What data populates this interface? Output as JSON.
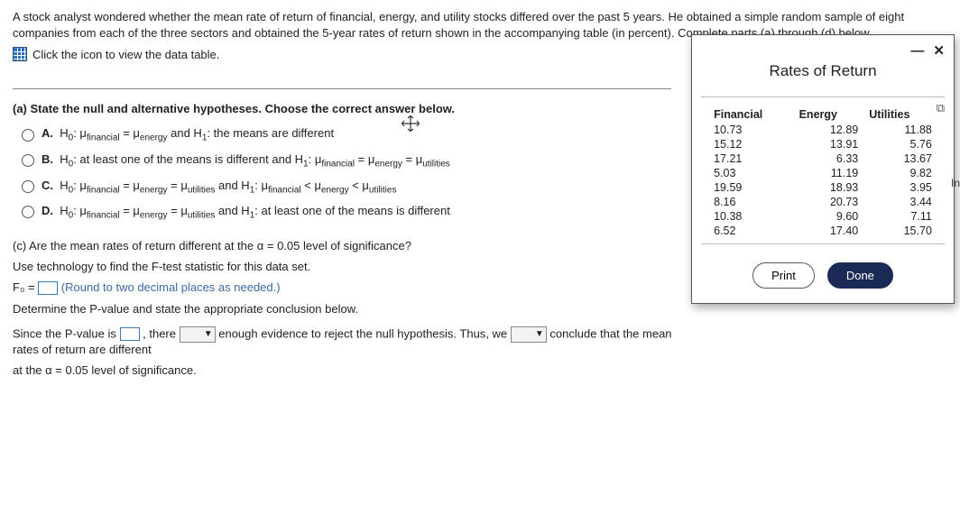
{
  "intro": "A stock analyst wondered whether the mean rate of return of financial, energy, and utility stocks differed over the past 5 years. He obtained a simple random sample of eight companies from each of the three sectors and obtained the 5-year rates of return shown in the accompanying table (in percent). Complete parts (a) through (d) below.",
  "iconRow": "Click the icon to view the data table.",
  "partA": {
    "prompt": "(a) State the null and alternative hypotheses. Choose the correct answer below.",
    "options": {
      "A": {
        "letter": "A.",
        "pre": "H",
        "sub0": "0",
        "text1": ": μ",
        "subF": "financial",
        "eq": " = μ",
        "subE": "energy",
        "tail": " and H",
        "sub1": "1",
        "tail2": ": the means are different"
      },
      "B": {
        "letter": "B.",
        "text": "H₀: at least one of the means is different and H₁: μfinancial = μenergy = μutilities"
      },
      "C": {
        "letter": "C.",
        "text": "H₀: μfinancial = μenergy = μutilities and H₁: μfinancial < μenergy < μutilities"
      },
      "D": {
        "letter": "D.",
        "text": "H₀: μfinancial = μenergy = μutilities and H₁: at least one of the means is different"
      }
    }
  },
  "partC": {
    "q": "(c) Are the mean rates of return different at the α = 0.05 level of significance?",
    "tech": "Use technology to find the F-test statistic for this data set.",
    "fstat_pre": "F₀ = ",
    "fstat_hint": "(Round to two decimal places as needed.)",
    "pval_line": "Determine the P-value and state the appropriate conclusion below.",
    "conc_pre": "Since the P-value is ",
    "conc_mid1": ", there ",
    "conc_mid2": " enough evidence to reject the null hypothesis. Thus, we ",
    "conc_tail": " conclude that the mean rates of return are different",
    "conc_last": "at the α = 0.05 level of significance."
  },
  "popup": {
    "title": "Rates of Return",
    "headers": [
      "Financial",
      "Energy",
      "Utilities"
    ],
    "rows": [
      [
        "10.73",
        "12.89",
        "11.88"
      ],
      [
        "15.12",
        "13.91",
        "5.76"
      ],
      [
        "17.21",
        "6.33",
        "13.67"
      ],
      [
        "5.03",
        "11.19",
        "9.82"
      ],
      [
        "19.59",
        "18.93",
        "3.95"
      ],
      [
        "8.16",
        "20.73",
        "3.44"
      ],
      [
        "10.38",
        "9.60",
        "7.11"
      ],
      [
        "6.52",
        "17.40",
        "15.70"
      ]
    ],
    "print": "Print",
    "done": "Done"
  },
  "sideTab": "In"
}
